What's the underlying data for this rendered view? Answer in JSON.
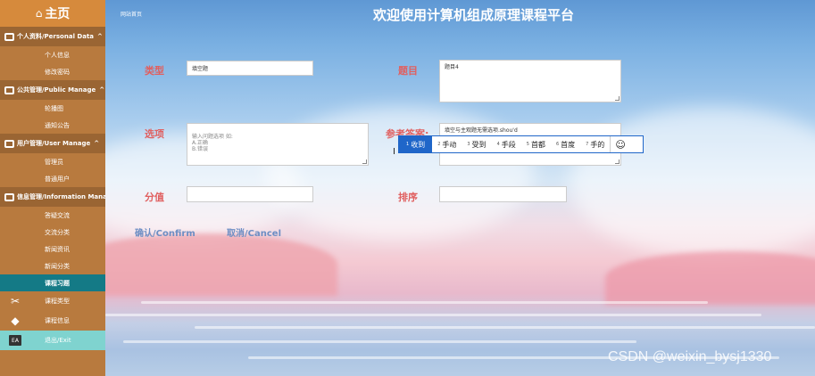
{
  "sidebar": {
    "home": "主页",
    "groups": [
      {
        "label": "个人资料/Personal Data",
        "caret": "^",
        "items": [
          "个人信息",
          "修改密码"
        ]
      },
      {
        "label": "公共管理/Public Manage",
        "caret": "^",
        "items": [
          "轮播图",
          "通知公告"
        ]
      },
      {
        "label": "用户管理/User Manage",
        "caret": "^",
        "items": [
          "管理员",
          "普通用户"
        ]
      },
      {
        "label": "信息管理/Information Manage",
        "caret": "",
        "items": [
          "答疑交流",
          "交流分类",
          "新闻资讯",
          "新闻分类",
          "课程习题"
        ]
      }
    ],
    "extra": [
      {
        "label": "课程类型",
        "icon": "✂"
      },
      {
        "label": "课程信息",
        "icon": "◆"
      },
      {
        "label": "退出/Exit",
        "icon": "EA"
      }
    ]
  },
  "header": {
    "breadcrumb": "网站首页",
    "title": "欢迎使用计算机组成原理课程平台"
  },
  "form": {
    "type_label": "类型",
    "type_value": "填空题",
    "question_label": "题目",
    "question_value": "题目4",
    "options_label": "选项",
    "options_placeholder": "输入问题选项 如:\nA.正确\nB.错误",
    "answer_label": "参考答案:",
    "answer_value": "填空与主观题无需选项.shou'd",
    "score_label": "分值",
    "score_value": "",
    "sort_label": "排序",
    "sort_value": "",
    "confirm": "确认/Confirm",
    "cancel": "取消/Cancel"
  },
  "ime": {
    "candidates": [
      {
        "n": "1",
        "t": "收到"
      },
      {
        "n": "2",
        "t": "手动"
      },
      {
        "n": "3",
        "t": "受到"
      },
      {
        "n": "4",
        "t": "手段"
      },
      {
        "n": "5",
        "t": "首都"
      },
      {
        "n": "6",
        "t": "首度"
      },
      {
        "n": "7",
        "t": "手的"
      }
    ],
    "emoji": "☺"
  },
  "watermark": "CSDN @weixin_bysj1330",
  "colors": {
    "sidebar": "#b87a3e",
    "sidebar_header": "#d68a3c",
    "active_item": "#147a86",
    "label": "#e06060",
    "button": "#6d8ec4",
    "ime_highlight": "#1f66c9"
  }
}
